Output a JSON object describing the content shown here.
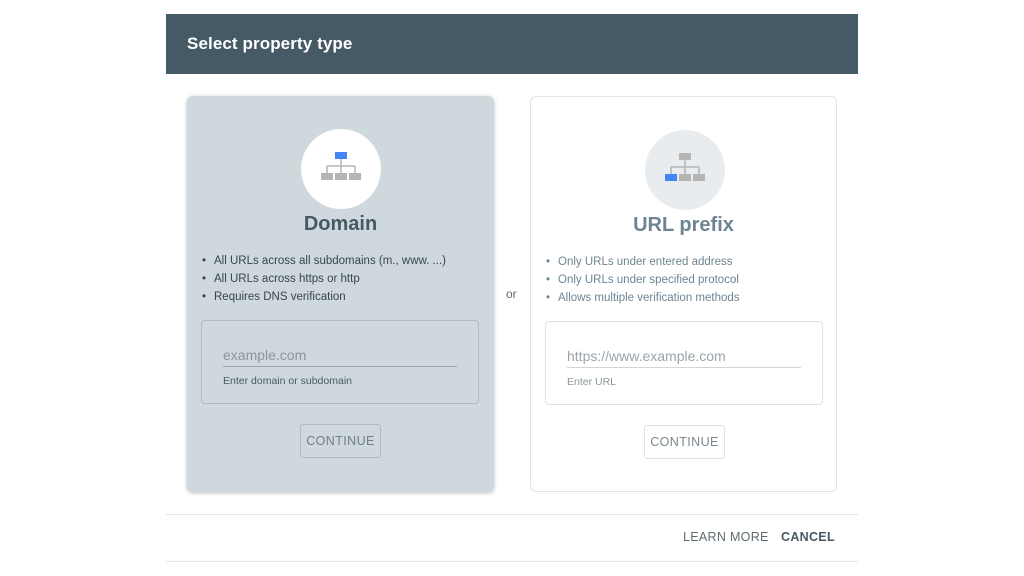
{
  "dialog": {
    "title": "Select property type"
  },
  "domain": {
    "title": "Domain",
    "icon": "domain-sitemap-icon",
    "bullets": [
      "All URLs across all subdomains (m., www. ...)",
      "All URLs across https or http",
      "Requires DNS verification"
    ],
    "input_placeholder": "example.com",
    "input_value": "",
    "helper": "Enter domain or subdomain",
    "continue_label": "CONTINUE"
  },
  "separator": "or",
  "url_prefix": {
    "title": "URL prefix",
    "icon": "url-prefix-sitemap-icon",
    "bullets": [
      "Only URLs under entered address",
      "Only URLs under specified protocol",
      "Allows multiple verification methods"
    ],
    "input_placeholder": "https://www.example.com",
    "input_value": "",
    "helper": "Enter URL",
    "continue_label": "CONTINUE"
  },
  "footer": {
    "learn_more": "LEARN MORE",
    "cancel": "CANCEL"
  },
  "colors": {
    "header_bg": "#455a64",
    "selected_card_bg": "#cfd8dc",
    "accent_blue": "#4285f4",
    "node_gray": "#b5b5b5"
  }
}
